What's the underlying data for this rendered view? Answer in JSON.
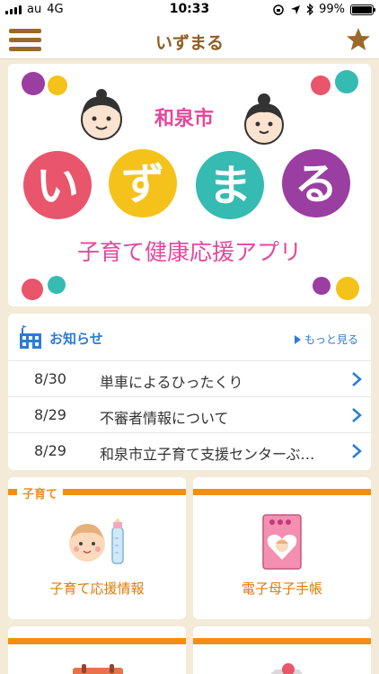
{
  "status_bar": {
    "carrier": "au",
    "network": "4G",
    "time": "10:33",
    "battery": "99%",
    "battery_level": 0.99
  },
  "nav": {
    "title": "いずまる"
  },
  "banner": {
    "city": "和泉市",
    "logo_chars": [
      "い",
      "ず",
      "ま",
      "る"
    ],
    "subtitle": "子育て健康応援アプリ"
  },
  "news": {
    "title": "お知らせ",
    "more_label": "もっと見る",
    "items": [
      {
        "date": "8/30",
        "text": "単車によるひったくり"
      },
      {
        "date": "8/29",
        "text": "不審者情報について"
      },
      {
        "date": "8/29",
        "text": "和泉市立子育て支援センターぶ…"
      }
    ]
  },
  "tiles": {
    "section_tag": "子育て",
    "support": {
      "label": "子育て応援情報"
    },
    "handbook": {
      "label": "電子母子手帳"
    }
  },
  "colors": {
    "brown": "#9b6a2a",
    "orange": "#f28f12",
    "blue": "#2b7cd6",
    "red": "#e9556b",
    "yellow": "#f4c21a",
    "teal": "#35bbb1",
    "purple": "#9a3ea1",
    "pink": "#e5479e"
  }
}
